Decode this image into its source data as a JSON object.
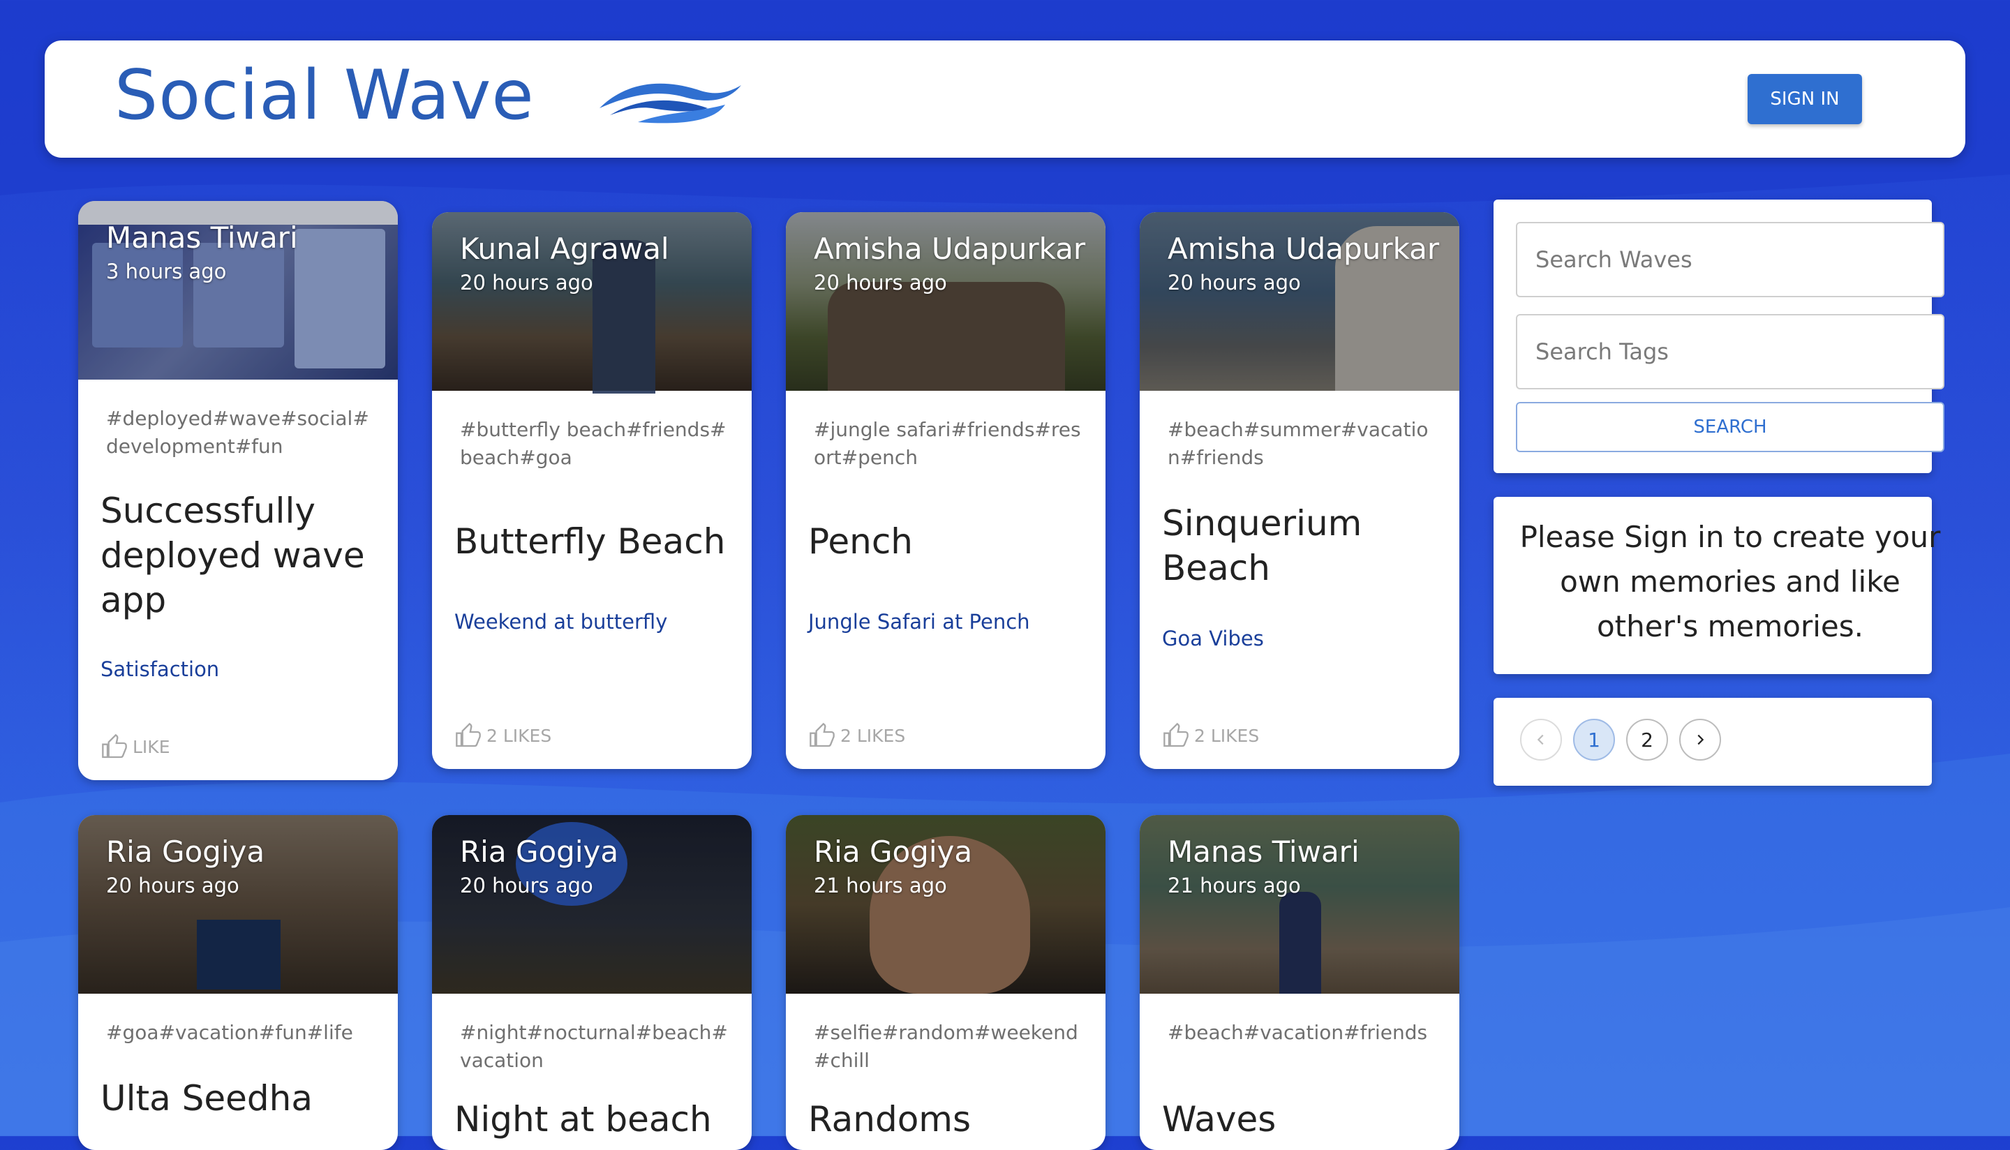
{
  "header": {
    "brand": "Social Wave",
    "signin_label": "SIGN IN"
  },
  "posts": [
    {
      "author": "Manas Tiwari",
      "time": "3 hours ago",
      "tags": "#deployed#wave#social#development#fun",
      "title": "Successfully deployed wave app",
      "message": "Satisfaction",
      "likes": "LIKE",
      "image": "screenshot-of-app"
    },
    {
      "author": "Kunal Agrawal",
      "time": "20 hours ago",
      "tags": "#butterfly beach#friends#beach#goa",
      "title": "Butterfly Beach",
      "message": "Weekend at butterfly",
      "likes": "2 LIKES",
      "image": "beach-person-photo"
    },
    {
      "author": "Amisha Udapurkar",
      "time": "20 hours ago",
      "tags": "#jungle safari#friends#resort#pench",
      "title": "Pench",
      "message": "Jungle Safari at Pench",
      "likes": "2 LIKES",
      "image": "group-photo"
    },
    {
      "author": "Amisha Udapurkar",
      "time": "20 hours ago",
      "tags": "#beach#summer#vacation#friends",
      "title": "Sinquerium Beach",
      "message": "Goa Vibes",
      "likes": "2 LIKES",
      "image": "seaside-photo"
    },
    {
      "author": "Ria Gogiya",
      "time": "20 hours ago",
      "tags": "#goa#vacation#fun#life",
      "title": "Ulta Seedha",
      "image": "room-photo"
    },
    {
      "author": "Ria Gogiya",
      "time": "20 hours ago",
      "tags": "#night#nocturnal#beach#vacation",
      "title": "Night at beach",
      "image": "night-photo"
    },
    {
      "author": "Ria Gogiya",
      "time": "21 hours ago",
      "tags": "#selfie#random#weekend#chill",
      "title": "Randoms",
      "image": "selfie-photo"
    },
    {
      "author": "Manas Tiwari",
      "time": "21 hours ago",
      "tags": "#beach#vacation#friends",
      "title": "Waves",
      "image": "beach-kid-photo"
    }
  ],
  "sidebar": {
    "search_waves_placeholder": "Search Waves",
    "search_tags_placeholder": "Search Tags",
    "search_label": "SEARCH",
    "signin_message": "Please Sign in to create your own memories and like other's memories.",
    "pagination": {
      "prev_icon": "chevron-left-icon",
      "pages": [
        "1",
        "2"
      ],
      "current": "1",
      "next_icon": "chevron-right-icon"
    }
  },
  "colors": {
    "brand": "#2a5db6",
    "accent": "#2f6fd0",
    "background": "#2346d4"
  }
}
